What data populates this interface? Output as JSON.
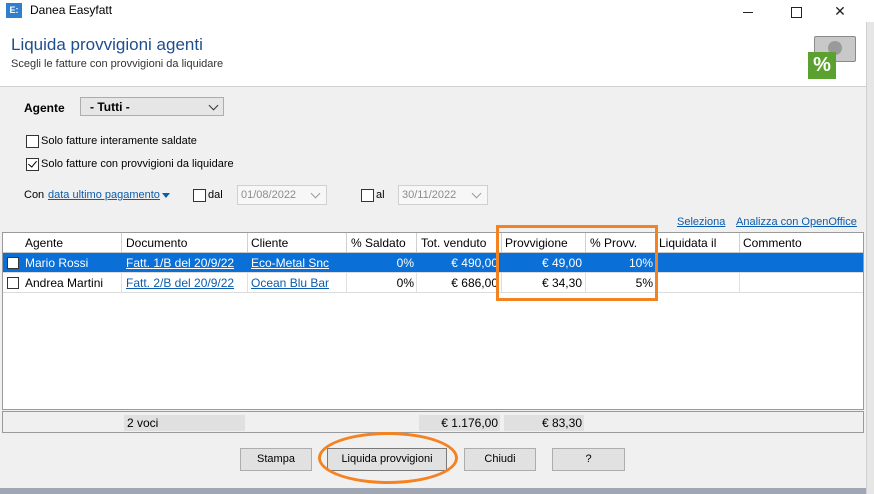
{
  "window": {
    "app_icon_text": "E:",
    "title": "Danea Easyfatt",
    "controls": [
      "minimize",
      "maximize",
      "close"
    ]
  },
  "header": {
    "title": "Liquida provvigioni agenti",
    "subtitle": "Scegli le fatture con provvigioni da liquidare",
    "icon": "commission-percent-icon",
    "icon_glyph": "%"
  },
  "filters": {
    "agente_label": "Agente",
    "agente_value": "- Tutti -",
    "opt_saldate": {
      "label": "Solo fatture interamente saldate",
      "checked": false
    },
    "opt_da_liquidare": {
      "label": "Solo fatture con provvigioni da liquidare",
      "checked": true
    },
    "con_label": "Con",
    "con_value": "data ultimo pagamento",
    "dal": {
      "label": "dal",
      "checked": false,
      "value": "01/08/2022"
    },
    "al": {
      "label": "al",
      "checked": false,
      "value": "30/11/2022"
    },
    "link_seleziona": "Seleziona",
    "link_openoffice": "Analizza con OpenOffice"
  },
  "table": {
    "columns": [
      "Agente",
      "Documento",
      "Cliente",
      "% Saldato",
      "Tot. venduto",
      "Provvigione",
      "% Provv.",
      "Liquidata il",
      "Commento"
    ],
    "rows": [
      {
        "checked": false,
        "agente": "Mario Rossi",
        "documento": "Fatt. 1/B del 20/9/22",
        "cliente": "Eco-Metal Snc",
        "saldato": "0%",
        "venduto": "€ 490,00",
        "provvigione": "€ 49,00",
        "perc_provv": "10%",
        "liquidata": "",
        "commento": "",
        "selected": true
      },
      {
        "checked": false,
        "agente": "Andrea Martini",
        "documento": "Fatt. 2/B del 20/9/22",
        "cliente": "Ocean Blu Bar",
        "saldato": "0%",
        "venduto": "€ 686,00",
        "provvigione": "€ 34,30",
        "perc_provv": "5%",
        "liquidata": "",
        "commento": "",
        "selected": false
      }
    ],
    "footer": {
      "count": "2 voci",
      "tot_venduto": "€ 1.176,00",
      "tot_provvigione": "€ 83,30"
    }
  },
  "buttons": {
    "stampa": "Stampa",
    "liquida": "Liquida provvigioni",
    "chiudi": "Chiudi",
    "help": "?"
  },
  "annotation_color": "#f58220"
}
